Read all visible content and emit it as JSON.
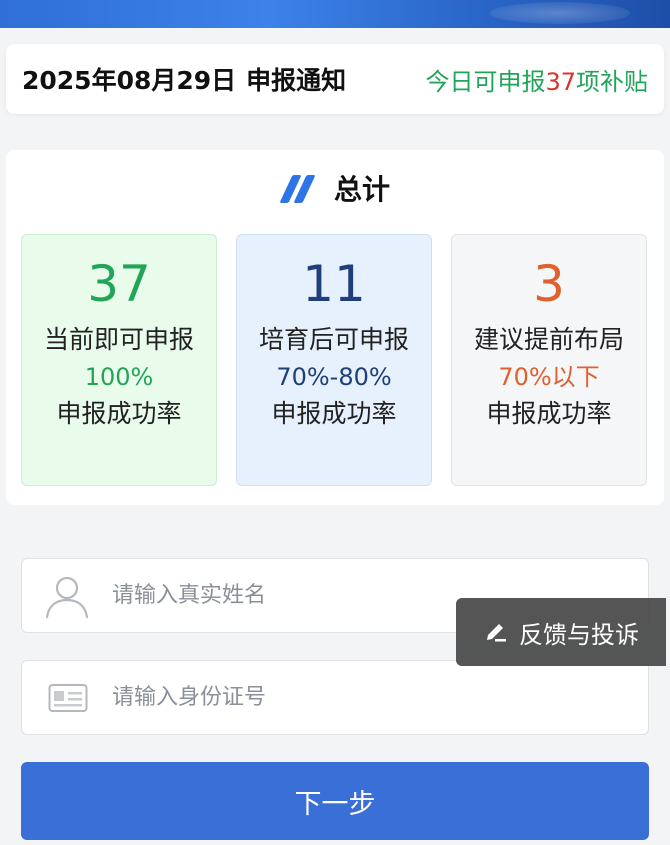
{
  "notice": {
    "date": "2025年08月29日",
    "title": "申报通知",
    "prefix": "今日可申报",
    "count": "37",
    "suffix": "项补贴",
    "color_green": "#22a559",
    "color_red": "#d9342b"
  },
  "summary": {
    "title": "总计",
    "title_icon": "double-slash-icon",
    "stats": [
      {
        "number": "37",
        "label": "当前即可申报",
        "rate": "100%",
        "foot": "申报成功率",
        "color": "#22a559"
      },
      {
        "number": "11",
        "label": "培育后可申报",
        "rate": "70%-80%",
        "foot": "申报成功率",
        "color": "#1f3f7a"
      },
      {
        "number": "3",
        "label": "建议提前布局",
        "rate": "70%以下",
        "foot": "申报成功率",
        "color": "#e0602e"
      }
    ]
  },
  "form": {
    "name_placeholder": "请输入真实姓名",
    "name_icon": "user-icon",
    "id_placeholder": "请输入身份证号",
    "id_icon": "id-card-icon",
    "next_label": "下一步",
    "accent": "#3a6fd8"
  },
  "feedback": {
    "label": "反馈与投诉",
    "icon": "pen-icon"
  }
}
